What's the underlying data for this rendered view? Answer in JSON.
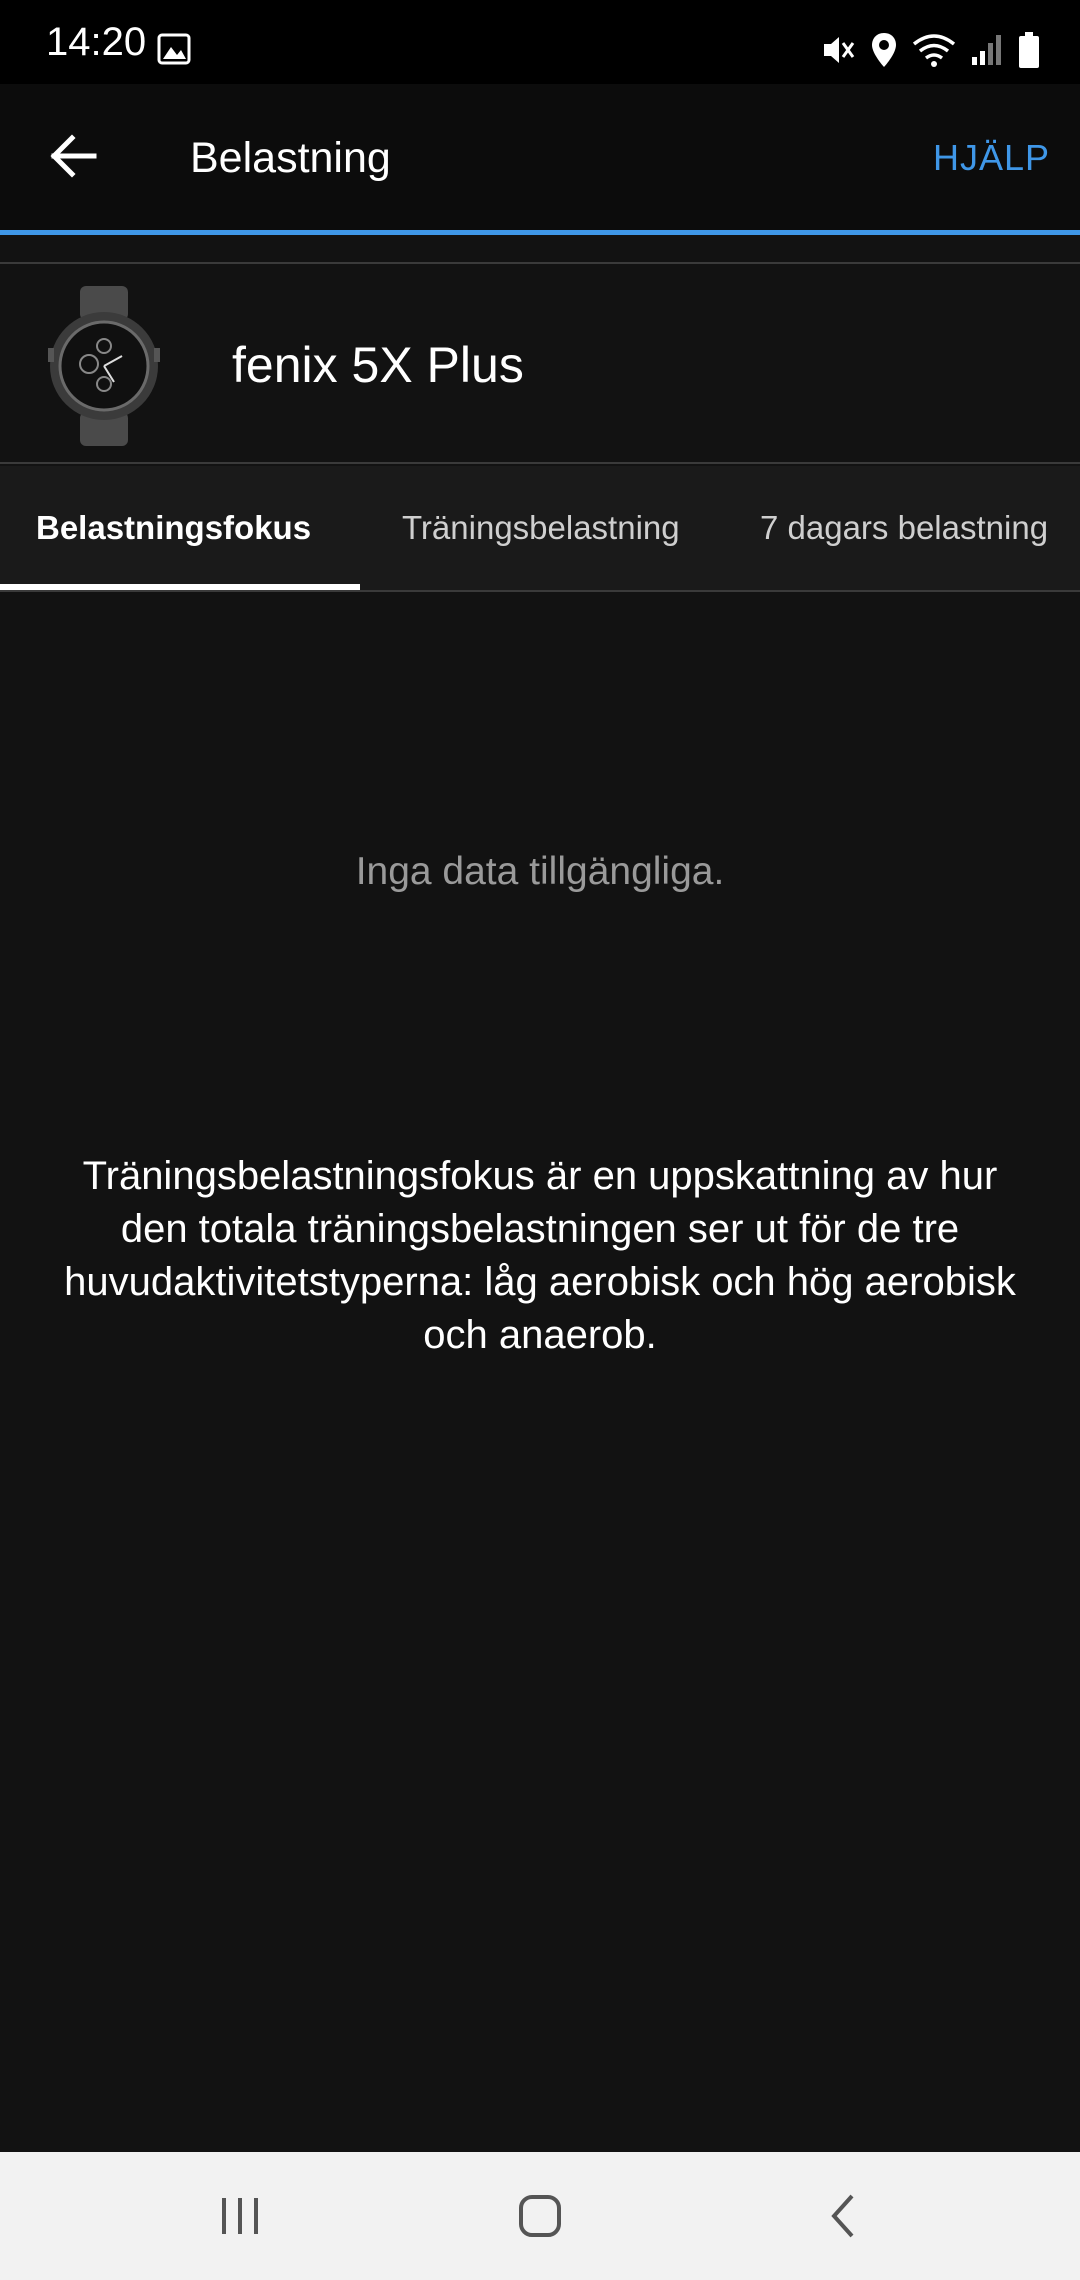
{
  "status_bar": {
    "time": "14:20",
    "icons": [
      "gallery-icon",
      "mute-icon",
      "location-icon",
      "wifi-icon",
      "signal-icon",
      "battery-icon"
    ]
  },
  "app_bar": {
    "title": "Belastning",
    "help_label": "HJÄLP",
    "accent_color": "#3f97e8"
  },
  "device": {
    "name": "fenix 5X Plus"
  },
  "tabs": [
    {
      "label": "Belastningsfokus",
      "active": true
    },
    {
      "label": "Träningsbelastning",
      "active": false
    },
    {
      "label": "7 dagars belastning",
      "active": false
    }
  ],
  "content": {
    "empty_message": "Inga data tillgängliga.",
    "description": "Träningsbelastningsfokus är en uppskattning av hur den totala träningsbelastningen ser ut för de tre huvudaktivitetstyperna: låg aerobisk och hög aerobisk och anaerob."
  },
  "nav_bar": {
    "icons": [
      "recent-apps-icon",
      "home-icon",
      "back-nav-icon"
    ]
  }
}
